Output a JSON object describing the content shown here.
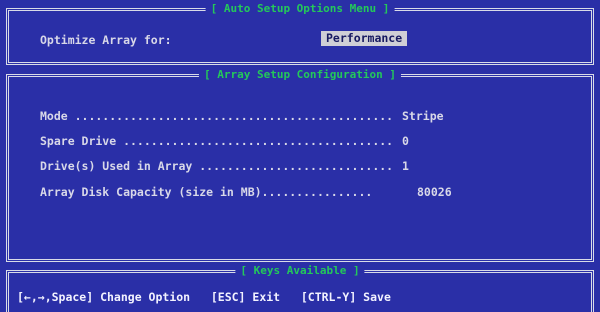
{
  "window": {
    "background": "#2A2FA7",
    "border_color": "#D9DBE8",
    "title_color": "#24C85A"
  },
  "auto_setup": {
    "title": "[ Auto Setup Options Menu ]",
    "optimize_label": "Optimize Array for:",
    "optimize_value": "Performance"
  },
  "array_config": {
    "title": "[ Array Setup Configuration ]",
    "rows": [
      {
        "label": "Mode ..............................................",
        "value": "Stripe"
      },
      {
        "label": "Spare Drive .......................................",
        "value": "0"
      },
      {
        "label": "Drive(s) Used in Array ............................",
        "value": "1"
      },
      {
        "label": "Array Disk Capacity (size in MB)................",
        "value": "80026"
      }
    ]
  },
  "keys_available": {
    "title": "[ Keys Available ]",
    "text": "[←,→,Space] Change Option   [ESC] Exit   [CTRL-Y] Save"
  }
}
